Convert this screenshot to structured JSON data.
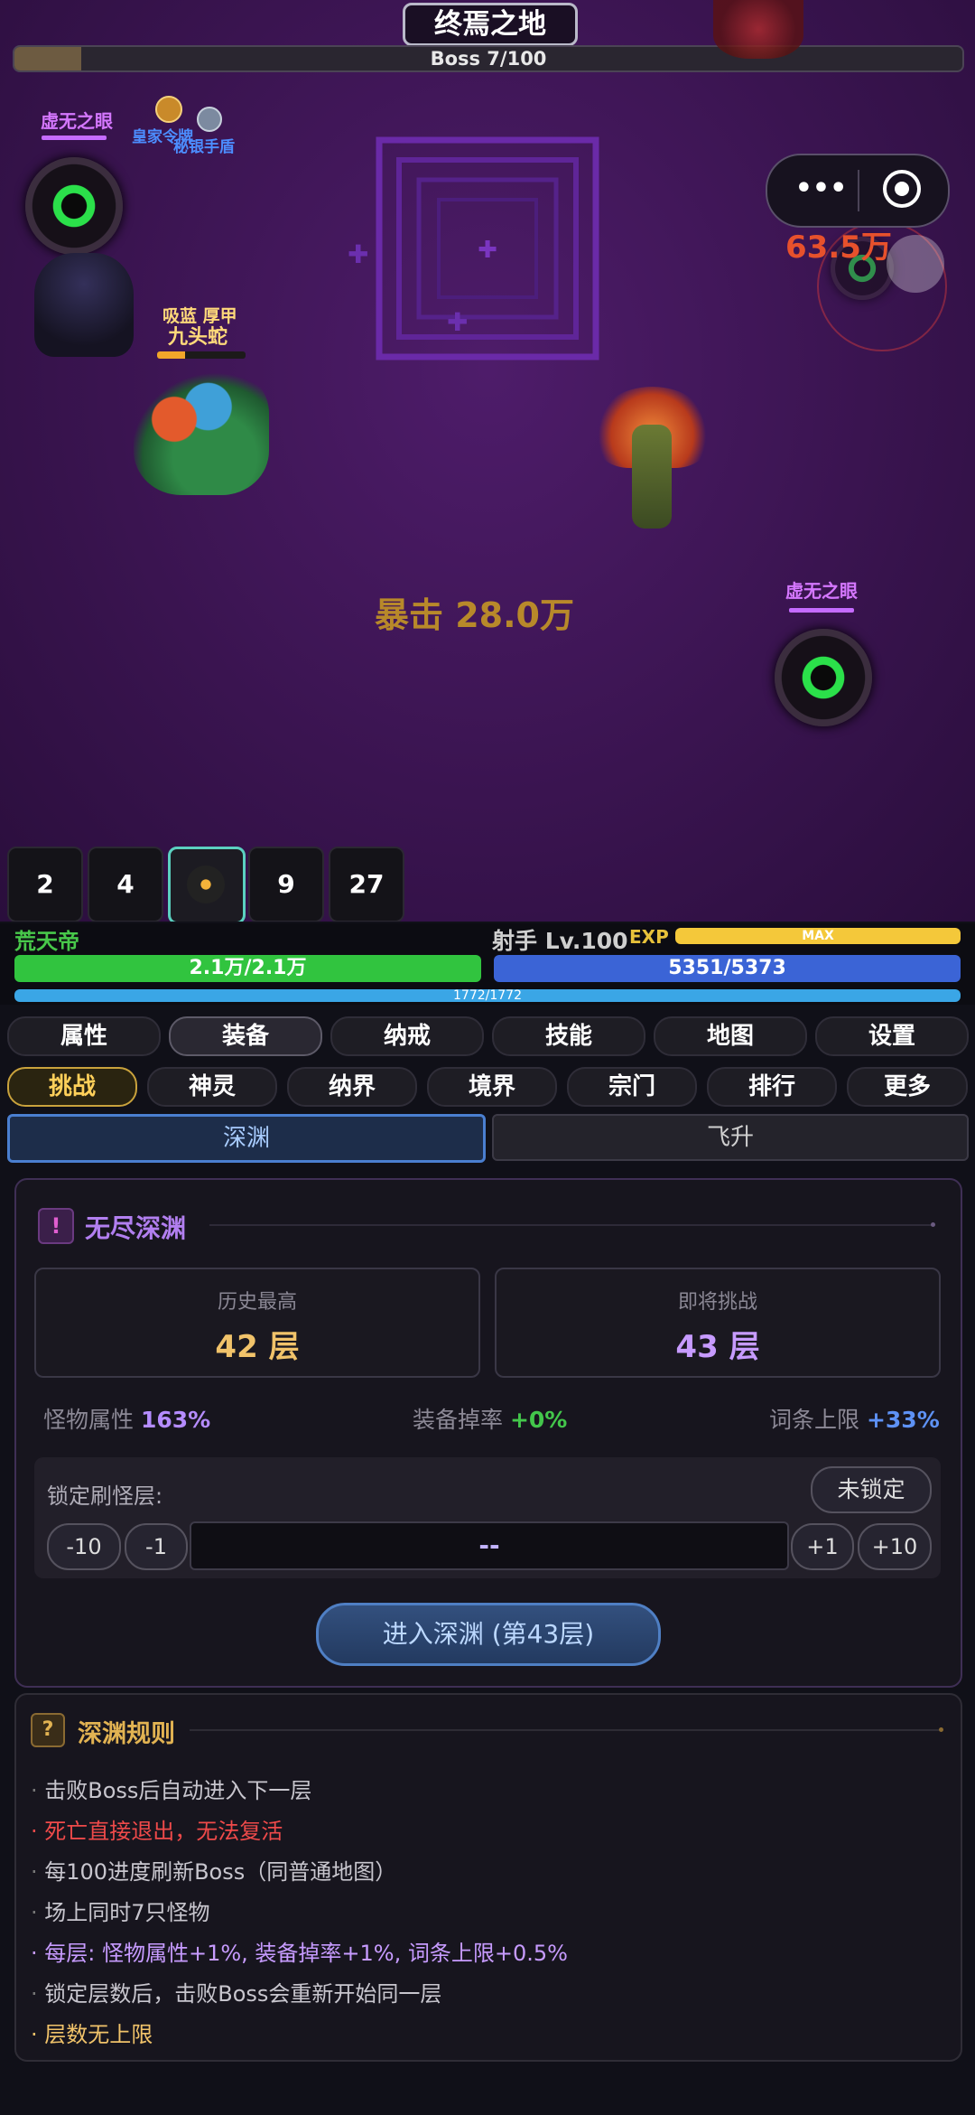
{
  "scene": {
    "zone_title": "终焉之地",
    "boss_progress_label": "Boss 7/100",
    "boss_progress_fraction": 0.07,
    "monster_label_left": "虚无之眼",
    "monster_label_right": "虚无之眼",
    "buff_1": "皇家令牌",
    "buff_2": "秘银手盾",
    "hydra_traits": "吸蓝 厚甲",
    "hydra_name": "九头蛇",
    "damage_right": "63.5万",
    "crit_text": "暴击 28.0万"
  },
  "skill_slots": [
    "2",
    "4",
    "",
    "9",
    "27"
  ],
  "player": {
    "name": "荒天帝",
    "class_level": "射手 Lv.100",
    "exp_label": "EXP",
    "exp_value": "MAX",
    "hp": "2.1万/2.1万",
    "mp": "5351/5373",
    "shield": "1772/1772"
  },
  "main_tabs": [
    "属性",
    "装备",
    "纳戒",
    "技能",
    "地图",
    "设置"
  ],
  "sub_tabs": [
    "挑战",
    "神灵",
    "纳界",
    "境界",
    "宗门",
    "排行",
    "更多"
  ],
  "segments": [
    "深渊",
    "飞升"
  ],
  "abyss": {
    "title": "无尽深渊",
    "best_label": "历史最高",
    "best_value": "42 层",
    "next_label": "即将挑战",
    "next_value": "43 层",
    "stat1_label": "怪物属性",
    "stat1_value": "163%",
    "stat2_label": "装备掉率",
    "stat2_value": "+0%",
    "stat3_label": "词条上限",
    "stat3_value": "+33%",
    "lock_label": "锁定刷怪层:",
    "lock_button": "未锁定",
    "minus10": "-10",
    "minus1": "-1",
    "lock_input": "--",
    "plus1": "+1",
    "plus10": "+10",
    "enter_button": "进入深渊 (第43层)"
  },
  "rules": {
    "title": "深渊规则",
    "items": [
      "击败Boss后自动进入下一层",
      "死亡直接退出，无法复活",
      "每100进度刷新Boss（同普通地图）",
      "场上同时7只怪物",
      "每层: 怪物属性+1%, 装备掉率+1%, 词条上限+0.5%",
      "锁定层数后，击败Boss会重新开始同一层",
      "层数无上限"
    ]
  },
  "colors": {
    "hp": "#31c43f",
    "mp": "#3b64d6",
    "shield": "#3aa6e6",
    "exp": "#f4c83a",
    "gold": "#f1c36a",
    "purple": "#c79bff",
    "danger": "#ef4a4a"
  }
}
